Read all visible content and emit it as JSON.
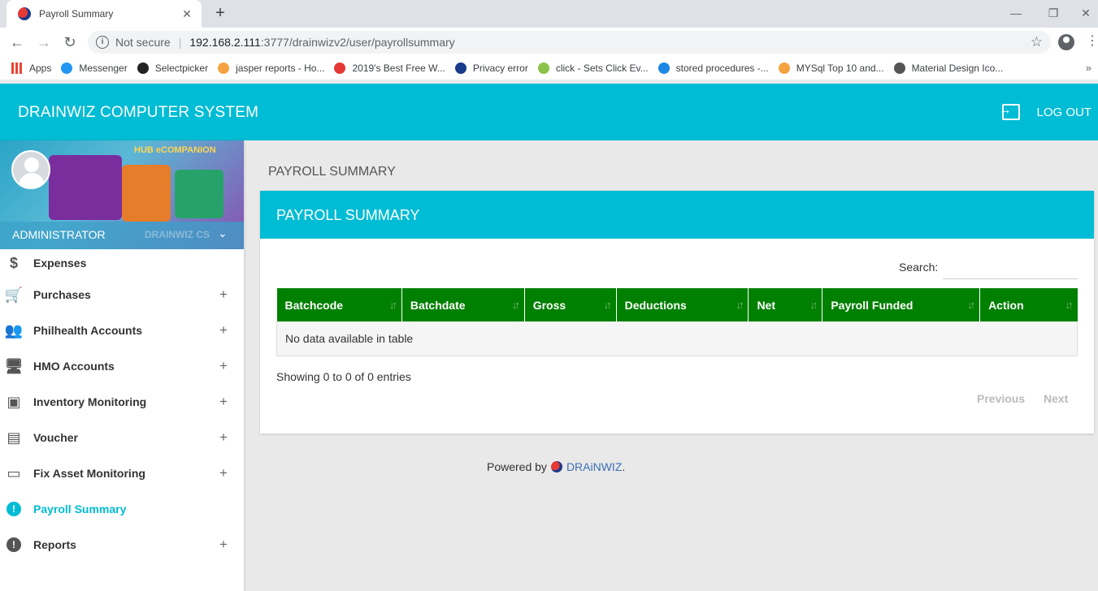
{
  "browser": {
    "tab_title": "Payroll Summary",
    "tab_close": "✕",
    "new_tab": "+",
    "minimize": "—",
    "restore": "❐",
    "close": "✕",
    "back": "←",
    "forward": "→",
    "reload": "↻",
    "info": "i",
    "security": "Not secure",
    "url_host": "192.168.2.111",
    "url_path": ":3777/drainwizv2/user/payrollsummary",
    "star": "☆",
    "menu": "⋮",
    "bookmarks": [
      {
        "label": "Apps",
        "color": "#4285f4"
      },
      {
        "label": "Messenger",
        "color": "#2196f3"
      },
      {
        "label": "Selectpicker",
        "color": "#222222"
      },
      {
        "label": "jasper reports - Ho...",
        "color": "#f4a340"
      },
      {
        "label": "2019's Best Free W...",
        "color": "#e53935"
      },
      {
        "label": "Privacy error",
        "color": "#1a3a8a"
      },
      {
        "label": "click - Sets Click Ev...",
        "color": "#8bc34a"
      },
      {
        "label": "stored procedures -...",
        "color": "#1e88e5"
      },
      {
        "label": "MYSql Top 10 and...",
        "color": "#f4a340"
      },
      {
        "label": "Material Design Ico...",
        "color": "#555555"
      }
    ],
    "bookmarks_more": "»"
  },
  "header": {
    "title": "DRAINWIZ COMPUTER SYSTEM",
    "logout": "LOG OUT"
  },
  "sidebar": {
    "banner_text": "HUB eCOMPANION",
    "user_role": "ADMINISTRATOR",
    "watermark": "DRAINWIZ CS",
    "chevron": "⌄",
    "items": [
      {
        "label": "Expenses",
        "icon": "$",
        "has_plus": false,
        "active": false
      },
      {
        "label": "Purchases",
        "icon": "🛒",
        "has_plus": true,
        "active": false
      },
      {
        "label": "Philhealth Accounts",
        "icon": "👥",
        "has_plus": true,
        "active": false
      },
      {
        "label": "HMO Accounts",
        "icon": "🖥",
        "has_plus": true,
        "active": false
      },
      {
        "label": "Inventory Monitoring",
        "icon": "▣",
        "has_plus": true,
        "active": false
      },
      {
        "label": "Voucher",
        "icon": "▤",
        "has_plus": true,
        "active": false
      },
      {
        "label": "Fix Asset Monitoring",
        "icon": "▭",
        "has_plus": true,
        "active": false
      },
      {
        "label": "Payroll Summary",
        "icon": "!",
        "has_plus": false,
        "active": true
      },
      {
        "label": "Reports",
        "icon": "!",
        "has_plus": true,
        "active": false
      }
    ],
    "plus": "+"
  },
  "main": {
    "page_heading": "PAYROLL SUMMARY",
    "card_title": "PAYROLL SUMMARY",
    "search_label": "Search:",
    "search_value": "",
    "columns": [
      "Batchcode",
      "Batchdate",
      "Gross",
      "Deductions",
      "Net",
      "Payroll Funded",
      "Action"
    ],
    "sort_icon": "↓↑",
    "empty_message": "No data available in table",
    "info": "Showing 0 to 0 of 0 entries",
    "previous": "Previous",
    "next": "Next"
  },
  "footer": {
    "prefix": "Powered by",
    "brand": "DRAiNWIZ",
    "suffix": "."
  },
  "colors": {
    "primary": "#00bcd4",
    "table_header": "#008000",
    "active_menu": "#00bcd4"
  }
}
